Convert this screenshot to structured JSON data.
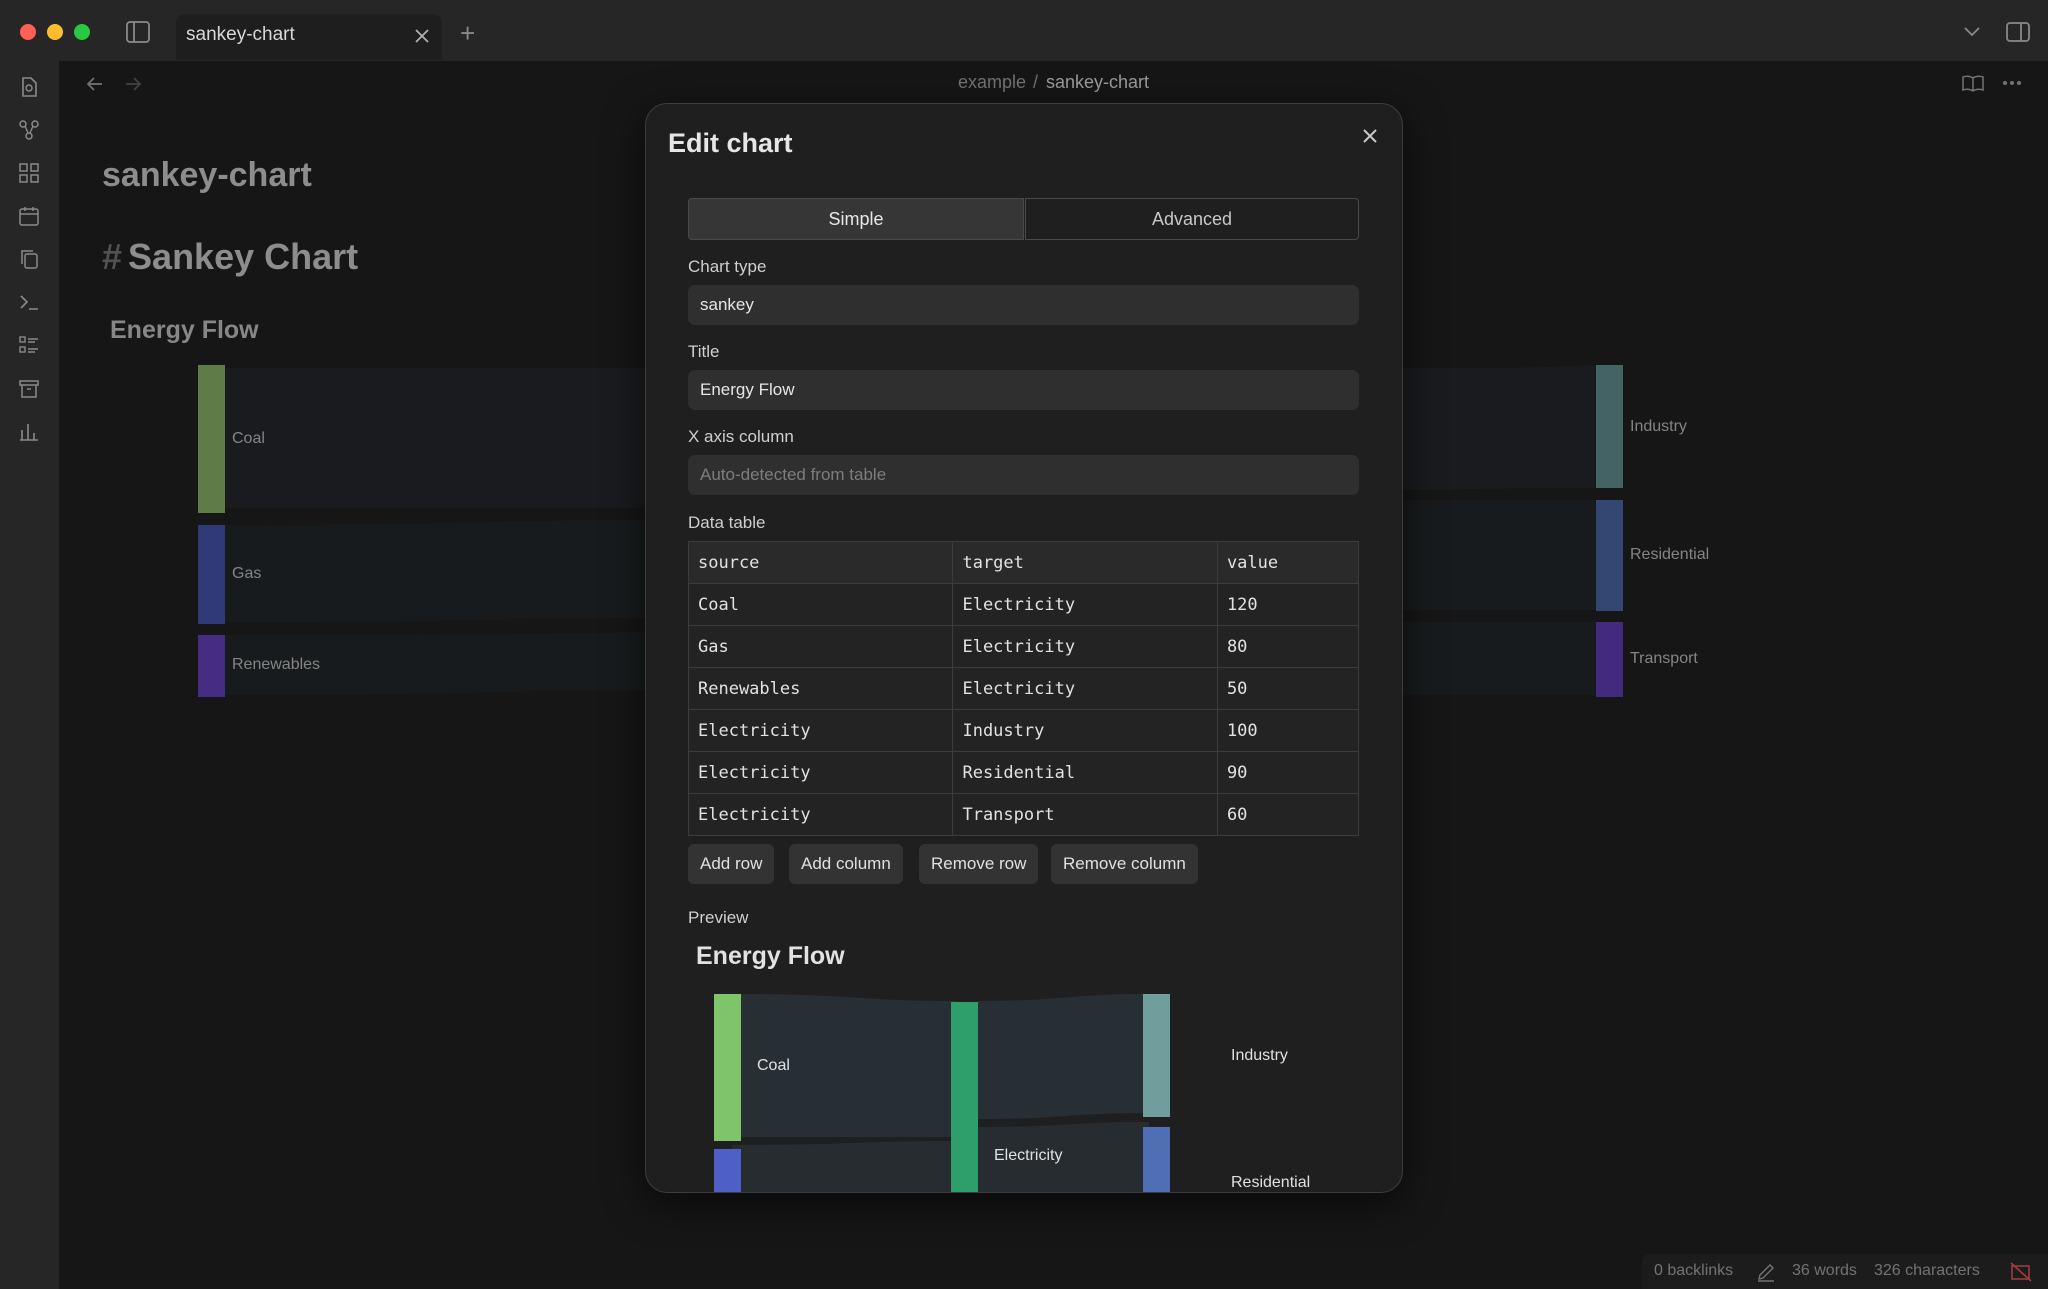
{
  "window": {
    "tab_title": "sankey-chart",
    "new_tab_symbol": "+"
  },
  "breadcrumb": {
    "folder": "example",
    "separator": "/",
    "file": "sankey-chart"
  },
  "note": {
    "title": "sankey-chart",
    "heading_hash": "#",
    "heading": "Sankey Chart",
    "chart_title": "Energy Flow",
    "source_nodes": [
      "Coal",
      "Gas",
      "Renewables"
    ],
    "target_nodes": [
      "Industry",
      "Residential",
      "Transport"
    ]
  },
  "modal": {
    "title": "Edit chart",
    "tabs": {
      "simple": "Simple",
      "advanced": "Advanced"
    },
    "chart_type_label": "Chart type",
    "chart_type_value": "sankey",
    "title_label": "Title",
    "title_value": "Energy Flow",
    "x_axis_label": "X axis column",
    "x_axis_placeholder": "Auto-detected from table",
    "data_table_label": "Data table",
    "table": {
      "headers": [
        "source",
        "target",
        "value"
      ],
      "rows": [
        [
          "Coal",
          "Electricity",
          "120"
        ],
        [
          "Gas",
          "Electricity",
          "80"
        ],
        [
          "Renewables",
          "Electricity",
          "50"
        ],
        [
          "Electricity",
          "Industry",
          "100"
        ],
        [
          "Electricity",
          "Residential",
          "90"
        ],
        [
          "Electricity",
          "Transport",
          "60"
        ]
      ]
    },
    "buttons": {
      "add_row": "Add row",
      "add_column": "Add column",
      "remove_row": "Remove row",
      "remove_column": "Remove column"
    },
    "preview_label": "Preview",
    "preview_title": "Energy Flow",
    "preview_nodes": {
      "coal": "Coal",
      "electricity": "Electricity",
      "industry": "Industry",
      "residential": "Residential"
    }
  },
  "statusbar": {
    "backlinks": "0 backlinks",
    "words": "36 words",
    "characters": "326 characters"
  },
  "colors": {
    "coal": "#7fc46a",
    "gas": "#4e5fc7",
    "renewables": "#6b3fc9",
    "electricity": "#2e9e6a",
    "industry": "#6f9e9c",
    "residential": "#4f6fb4",
    "transport": "#6a40c4"
  },
  "chart_data": {
    "type": "sankey",
    "title": "Energy Flow",
    "links": [
      {
        "source": "Coal",
        "target": "Electricity",
        "value": 120
      },
      {
        "source": "Gas",
        "target": "Electricity",
        "value": 80
      },
      {
        "source": "Renewables",
        "target": "Electricity",
        "value": 50
      },
      {
        "source": "Electricity",
        "target": "Industry",
        "value": 100
      },
      {
        "source": "Electricity",
        "target": "Residential",
        "value": 90
      },
      {
        "source": "Electricity",
        "target": "Transport",
        "value": 60
      }
    ]
  }
}
